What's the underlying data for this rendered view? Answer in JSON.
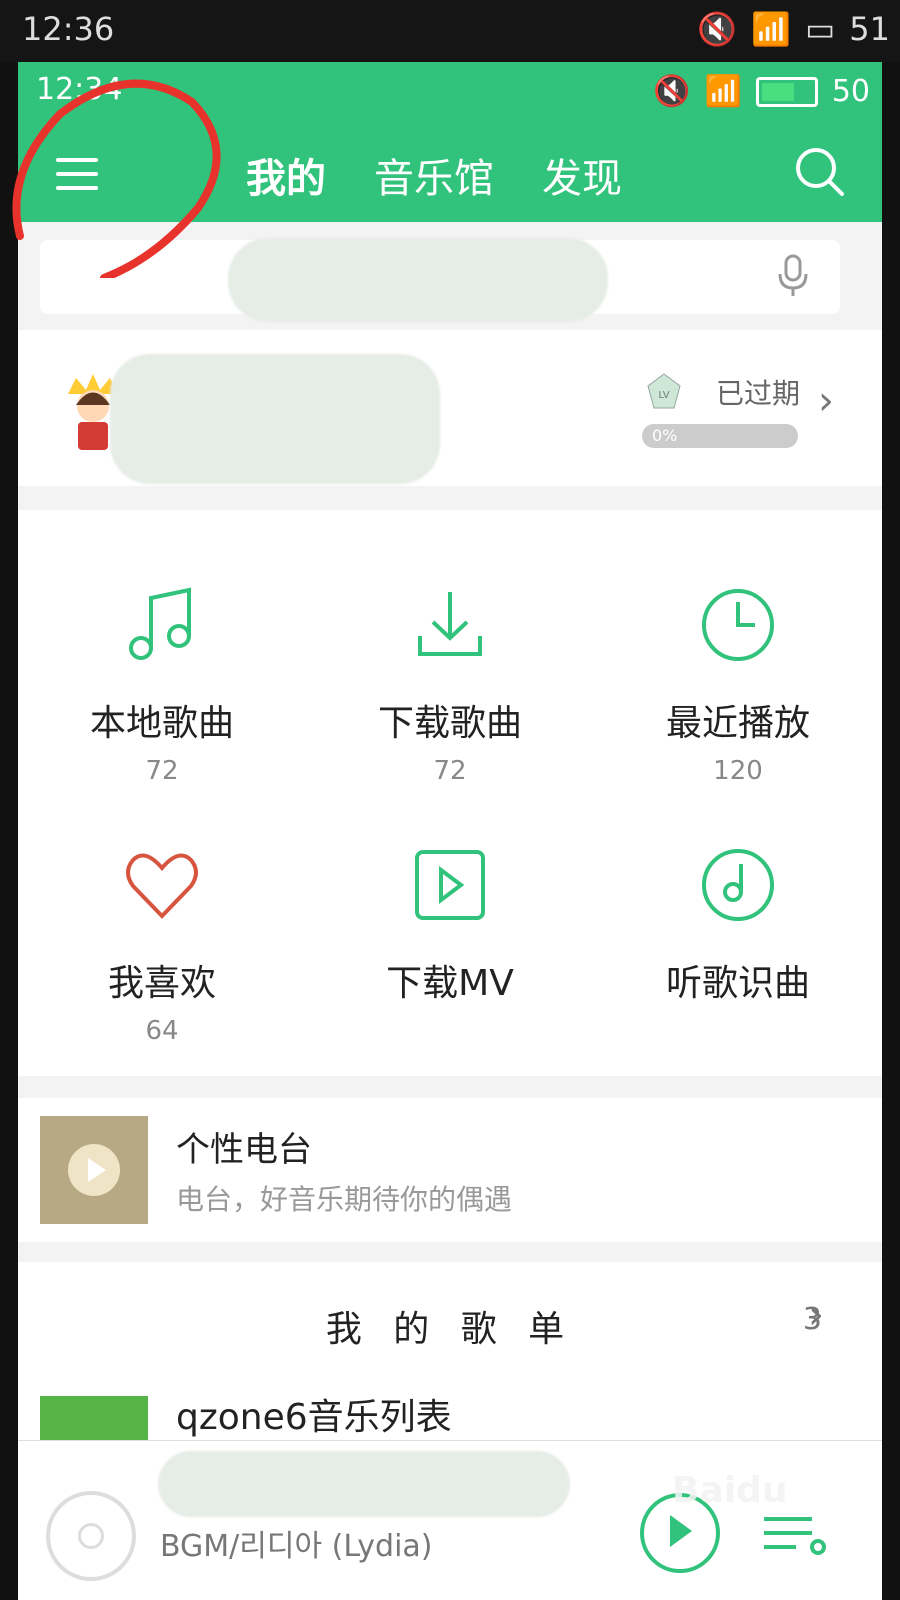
{
  "outer_status": {
    "time": "12:36",
    "battery": "51"
  },
  "inner_status": {
    "time": "12:34",
    "battery": "50"
  },
  "tabs": [
    "我的",
    "音乐馆",
    "发现"
  ],
  "profile": {
    "status": "已过期",
    "progress_label": "0%",
    "progress_value": 0
  },
  "grid": [
    {
      "label": "本地歌曲",
      "count": "72",
      "icon": "music-note-icon"
    },
    {
      "label": "下载歌曲",
      "count": "72",
      "icon": "download-icon"
    },
    {
      "label": "最近播放",
      "count": "120",
      "icon": "clock-icon"
    },
    {
      "label": "我喜欢",
      "count": "64",
      "icon": "heart-icon"
    },
    {
      "label": "下载MV",
      "count": "",
      "icon": "play-square-icon"
    },
    {
      "label": "听歌识曲",
      "count": "",
      "icon": "music-recognition-icon"
    }
  ],
  "radio": {
    "title": "个性电台",
    "subtitle": "电台，好音乐期待你的偶遇"
  },
  "playlists": {
    "title": "我 的 歌 单",
    "count": "3",
    "first_item": "qzone6音乐列表"
  },
  "player": {
    "artist": "BGM/리디아 (Lydia)"
  },
  "colors": {
    "brand": "#31c27c",
    "heart": "#d7553f"
  }
}
